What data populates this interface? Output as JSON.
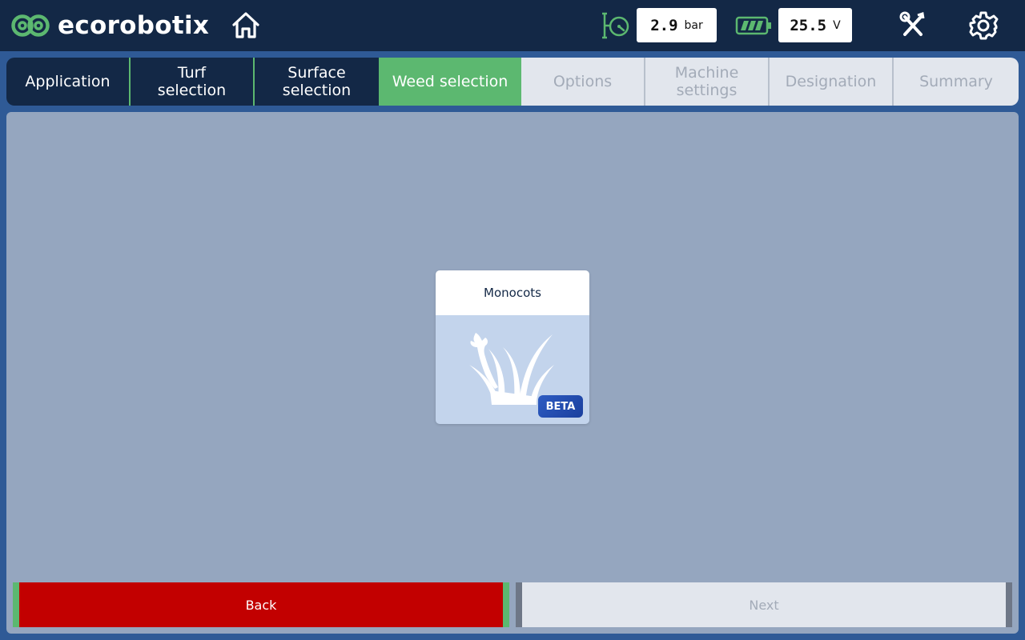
{
  "app": {
    "brand": "ecorobotix"
  },
  "header": {
    "pressure": {
      "value": "2.9",
      "unit": "bar"
    },
    "voltage": {
      "value": "25.5",
      "unit": "V"
    }
  },
  "tabs": [
    {
      "label": "Application",
      "state": "done"
    },
    {
      "label": "Turf selection",
      "state": "done"
    },
    {
      "label": "Surface selection",
      "state": "done"
    },
    {
      "label": "Weed selection",
      "state": "active"
    },
    {
      "label": "Options",
      "state": "todo"
    },
    {
      "label": "Machine settings",
      "state": "todo"
    },
    {
      "label": "Designation",
      "state": "todo"
    },
    {
      "label": "Summary",
      "state": "todo"
    }
  ],
  "card": {
    "title": "Monocots",
    "badge": "BETA"
  },
  "footer": {
    "back_label": "Back",
    "next_label": "Next"
  },
  "colors": {
    "accent_green": "#5cb870",
    "navy": "#132846",
    "back_red": "#c20000"
  }
}
